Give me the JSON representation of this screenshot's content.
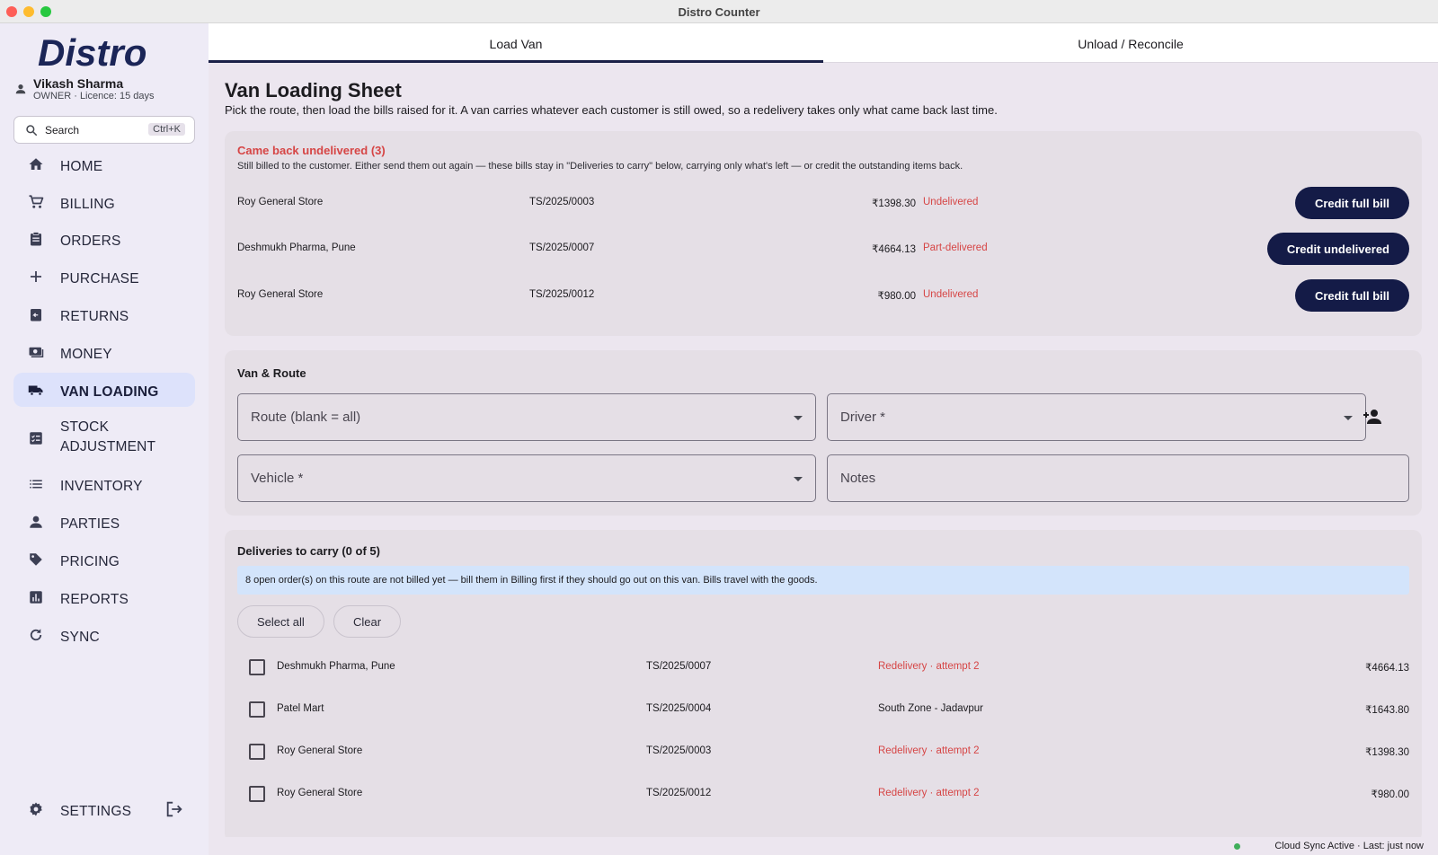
{
  "window": {
    "title": "Distro Counter"
  },
  "sidebar": {
    "logo_text": "Distro",
    "user_name": "Vikash Sharma",
    "user_role": "OWNER · Licence: 15 days",
    "search_label": "Search",
    "search_shortcut": "Ctrl+K",
    "items": [
      {
        "label": "HOME",
        "icon": "home-icon"
      },
      {
        "label": "BILLING",
        "icon": "cart-icon"
      },
      {
        "label": "ORDERS",
        "icon": "clipboard-icon"
      },
      {
        "label": "PURCHASE",
        "icon": "plus-icon"
      },
      {
        "label": "RETURNS",
        "icon": "return-icon"
      },
      {
        "label": "MONEY",
        "icon": "money-icon"
      },
      {
        "label": "VAN LOADING",
        "icon": "truck-icon",
        "active": true
      },
      {
        "label": "STOCK\nADJUSTMENT",
        "icon": "checklist-icon"
      },
      {
        "label": "INVENTORY",
        "icon": "list-icon"
      },
      {
        "label": "PARTIES",
        "icon": "person-icon"
      },
      {
        "label": "PRICING",
        "icon": "tag-icon"
      },
      {
        "label": "REPORTS",
        "icon": "chart-icon"
      },
      {
        "label": "SYNC",
        "icon": "sync-icon"
      }
    ],
    "settings_label": "SETTINGS"
  },
  "tabs": [
    {
      "label": "Load Van",
      "active": true
    },
    {
      "label": "Unload / Reconcile",
      "active": false
    }
  ],
  "page": {
    "title": "Van Loading Sheet",
    "subtitle": "Pick the route, then load the bills raised for it. A van carries whatever each customer is still owed, so a redelivery takes only what came back last time."
  },
  "undelivered": {
    "title": "Came back undelivered (3)",
    "note": "Still billed to the customer. Either send them out again — these bills stay in \"Deliveries to carry\" below, carrying only what's left — or credit the outstanding items back.",
    "rows": [
      {
        "party": "Roy General Store",
        "bill": "TS/2025/0003",
        "amount": "₹1398.30",
        "status": "Undelivered",
        "action": "Credit full bill"
      },
      {
        "party": "Deshmukh Pharma, Pune",
        "bill": "TS/2025/0007",
        "amount": "₹4664.13",
        "status": "Part-delivered",
        "action": "Credit undelivered"
      },
      {
        "party": "Roy General Store",
        "bill": "TS/2025/0012",
        "amount": "₹980.00",
        "status": "Undelivered",
        "action": "Credit full bill"
      }
    ]
  },
  "van_route": {
    "title": "Van & Route",
    "route_label": "Route (blank = all)",
    "driver_label": "Driver *",
    "vehicle_label": "Vehicle *",
    "notes_label": "Notes"
  },
  "deliveries": {
    "title": "Deliveries to carry (0 of 5)",
    "info": "8 open order(s) on this route are not billed yet — bill them in Billing first if they should go out on this van. Bills travel with the goods.",
    "select_all_label": "Select all",
    "clear_label": "Clear",
    "rows": [
      {
        "party": "Deshmukh Pharma, Pune",
        "bill": "TS/2025/0007",
        "status": "Redelivery · attempt 2",
        "highlight": true,
        "amount": "₹4664.13",
        "checked": false
      },
      {
        "party": "Patel Mart",
        "bill": "TS/2025/0004",
        "status": "South Zone - Jadavpur",
        "highlight": false,
        "amount": "₹1643.80",
        "checked": false
      },
      {
        "party": "Roy General Store",
        "bill": "TS/2025/0003",
        "status": "Redelivery · attempt 2",
        "highlight": true,
        "amount": "₹1398.30",
        "checked": false
      },
      {
        "party": "Roy General Store",
        "bill": "TS/2025/0012",
        "status": "Redelivery · attempt 2",
        "highlight": true,
        "amount": "₹980.00",
        "checked": false
      }
    ]
  },
  "statusbar": {
    "text": "Cloud Sync Active · Last: just now"
  },
  "colors": {
    "accent": "#141b47",
    "alert": "#d64545",
    "info_bg": "#d3e4fb",
    "nav_active": "#dde2fb",
    "sync_ok": "#3fae5a"
  }
}
